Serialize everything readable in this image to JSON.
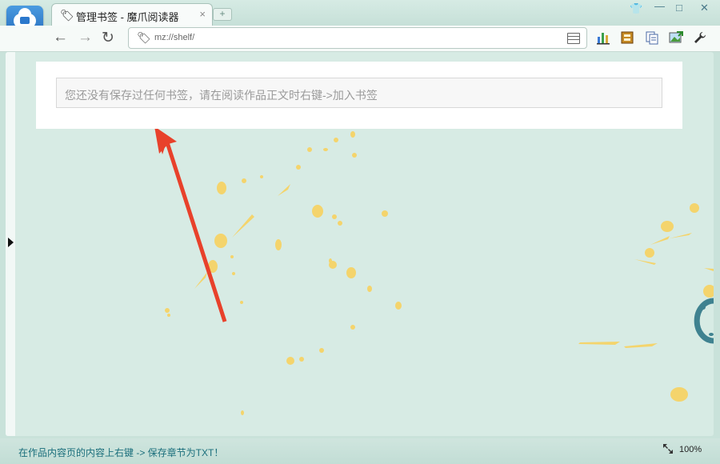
{
  "tab": {
    "title": "管理书签 - 魔爪阅读器",
    "close": "×",
    "new_tab": "+"
  },
  "window": {
    "skin": "👕",
    "minimize": "—",
    "maximize": "□",
    "close": "✕"
  },
  "nav": {
    "back": "←",
    "forward": "→",
    "reload": "↻"
  },
  "address": {
    "url": "mz://shelf/"
  },
  "icons": {
    "logo": "cloud-book-icon",
    "tag": "tag-icon",
    "tools": [
      "chart-icon",
      "film-icon",
      "documents-icon",
      "image-arrow-icon",
      "wrench-icon"
    ]
  },
  "colors": {
    "accent": "#1b6f7c",
    "arrow": "#e8412b",
    "splash": "#f4d46c",
    "background": "#d7ebe4"
  },
  "content": {
    "notice": "您还没有保存过任何书签，请在阅读作品正文时右键->加入书签"
  },
  "status": {
    "tip": "在作品内容页的内容上右键 -> 保存章节为TXT！",
    "zoom": "100%"
  }
}
